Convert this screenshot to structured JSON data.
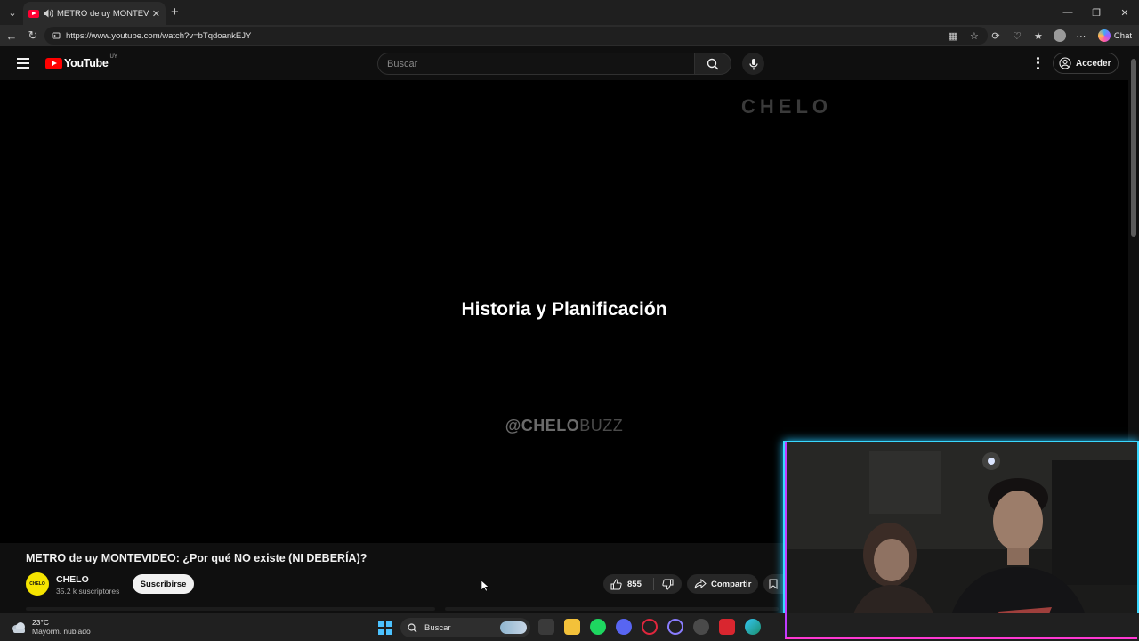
{
  "browser": {
    "tab_title": "METRO de uy MONTEVIDEO: ¿Por qué NO existe (NI DEBERÍA)?",
    "url": "https://www.youtube.com/watch?v=bTqdoankEJY",
    "chat_label": "Chat"
  },
  "youtube": {
    "wordmark": "YouTube",
    "region": "UY",
    "search_placeholder": "Buscar",
    "signin_label": "Acceder"
  },
  "video": {
    "watermark": "CHELO",
    "overlay_title": "Historia y Planificación",
    "handle_bold": "@CHELO",
    "handle_light": "BUZZ"
  },
  "watch": {
    "title": "METRO de uy MONTEVIDEO: ¿Por qué NO existe (NI DEBERÍA)?",
    "channel": "CHELO",
    "avatar_text": "CHELO",
    "subscribers": "35.2 k suscriptores",
    "subscribe_label": "Suscribirse",
    "likes": "855",
    "share_label": "Compartir"
  },
  "taskbar": {
    "temperature": "23°C",
    "condition": "Mayorm. nublado",
    "search_label": "Buscar"
  },
  "colors": {
    "youtube_red": "#ff0000",
    "accent_blue": "#4cc2ff",
    "webcam_cyan": "#39d8ff",
    "webcam_pink": "#ff38d2"
  }
}
